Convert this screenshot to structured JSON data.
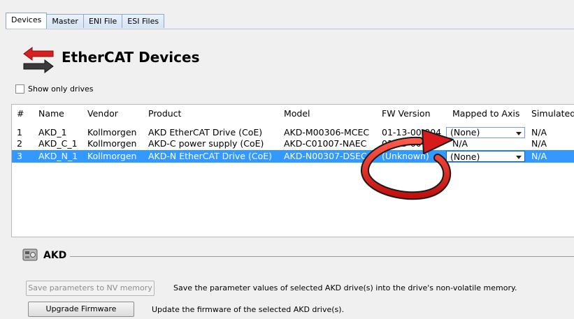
{
  "tabs": [
    {
      "label": "Devices",
      "active": true
    },
    {
      "label": "Master",
      "active": false
    },
    {
      "label": "ENI File",
      "active": false
    },
    {
      "label": "ESI Files",
      "active": false
    }
  ],
  "header": {
    "title": "EtherCAT Devices",
    "icon": "red-double-arrow-icon"
  },
  "filter": {
    "show_only_drives_label": "Show only drives",
    "checked": false
  },
  "table": {
    "columns": [
      "#",
      "Name",
      "Vendor",
      "Product",
      "Model",
      "FW Version",
      "Mapped to Axis",
      "Simulated"
    ],
    "rows": [
      {
        "num": "1",
        "name": "AKD_1",
        "vendor": "Kollmorgen",
        "product": "AKD EtherCAT Drive (CoE)",
        "model": "AKD-M00306-MCEC",
        "fw": "01-13-00-004",
        "mapped": "(None)",
        "mapped_is_dropdown": true,
        "simulated": "N/A",
        "selected": false
      },
      {
        "num": "2",
        "name": "AKD_C_1",
        "vendor": "Kollmorgen",
        "product": "AKD-C power supply (CoE)",
        "model": "AKD-C01007-NAEC",
        "fw": "01-13-00-004",
        "mapped": "N/A",
        "mapped_is_dropdown": false,
        "simulated": "N/A",
        "selected": false
      },
      {
        "num": "3",
        "name": "AKD_N_1",
        "vendor": "Kollmorgen",
        "product": "AKD-N EtherCAT Drive (CoE)",
        "model": "AKD-N00307-DSEC",
        "fw": "(Unknown)",
        "mapped": "(None)",
        "mapped_is_dropdown": true,
        "simulated": "N/A",
        "selected": true
      }
    ]
  },
  "akd": {
    "title": "AKD",
    "icon": "drive-icon",
    "save_button": "Save parameters to NV memory",
    "save_desc": "Save the parameter values of selected AKD drive(s) into the drive's non-volatile memory.",
    "upgrade_button": "Upgrade Firmware",
    "upgrade_desc": "Update the firmware of the selected AKD drive(s)."
  },
  "colors": {
    "selection": "#3399ff",
    "annotation": "#e02020"
  }
}
